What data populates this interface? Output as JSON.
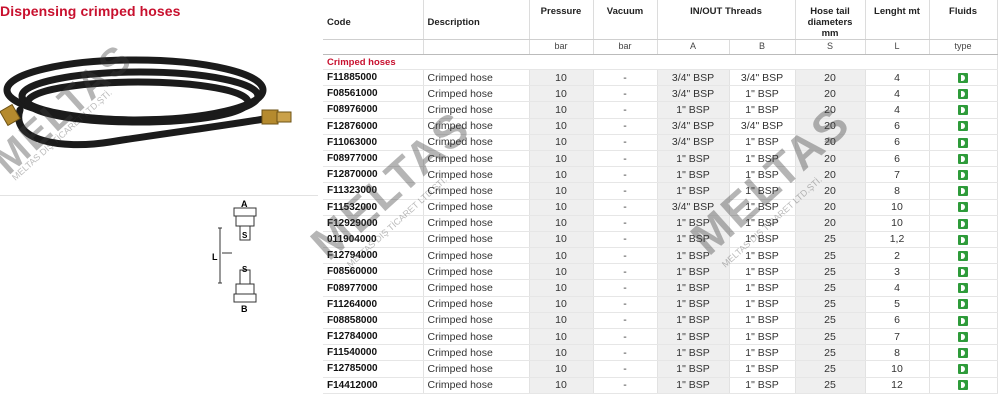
{
  "title": "Dispensing crimped hoses",
  "diagram": {
    "label_a": "A",
    "label_s1": "S",
    "label_l": "L",
    "label_s2": "S",
    "label_b": "B"
  },
  "watermark": {
    "text": "MELTAS",
    "subtext": "MELTAS DIŞ TİCARET LTD.ŞTİ."
  },
  "table": {
    "headers": {
      "code": "Code",
      "description": "Description",
      "pressure": "Pressure",
      "vacuum": "Vacuum",
      "threads": "IN/OUT Threads",
      "hose_tail": "Hose tail diameters mm",
      "length": "Lenght mt",
      "fluids": "Fluids"
    },
    "subheaders": {
      "pressure": "bar",
      "vacuum": "bar",
      "a": "A",
      "b": "B",
      "s": "S",
      "l": "L",
      "fluids": "type"
    },
    "group_label": "Crimped hoses",
    "fluid_icon": "diesel-fluid-icon",
    "fluid_color": "#2e9b3a",
    "rows": [
      {
        "code": "F11885000",
        "desc": "Crimped hose",
        "pressure": "10",
        "vacuum": "-",
        "a": "3/4\" BSP",
        "b": "3/4\" BSP",
        "s": "20",
        "l": "4"
      },
      {
        "code": "F08561000",
        "desc": "Crimped hose",
        "pressure": "10",
        "vacuum": "-",
        "a": "3/4\" BSP",
        "b": "1\" BSP",
        "s": "20",
        "l": "4"
      },
      {
        "code": "F08976000",
        "desc": "Crimped hose",
        "pressure": "10",
        "vacuum": "-",
        "a": "1\" BSP",
        "b": "1\" BSP",
        "s": "20",
        "l": "4"
      },
      {
        "code": "F12876000",
        "desc": "Crimped hose",
        "pressure": "10",
        "vacuum": "-",
        "a": "3/4\" BSP",
        "b": "3/4\" BSP",
        "s": "20",
        "l": "6"
      },
      {
        "code": "F11063000",
        "desc": "Crimped hose",
        "pressure": "10",
        "vacuum": "-",
        "a": "3/4\" BSP",
        "b": "1\" BSP",
        "s": "20",
        "l": "6"
      },
      {
        "code": "F08977000",
        "desc": "Crimped hose",
        "pressure": "10",
        "vacuum": "-",
        "a": "1\" BSP",
        "b": "1\" BSP",
        "s": "20",
        "l": "6"
      },
      {
        "code": "F12870000",
        "desc": "Crimped hose",
        "pressure": "10",
        "vacuum": "-",
        "a": "1\" BSP",
        "b": "1\" BSP",
        "s": "20",
        "l": "7"
      },
      {
        "code": "F11323000",
        "desc": "Crimped hose",
        "pressure": "10",
        "vacuum": "-",
        "a": "1\" BSP",
        "b": "1\" BSP",
        "s": "20",
        "l": "8"
      },
      {
        "code": "F11532000",
        "desc": "Crimped hose",
        "pressure": "10",
        "vacuum": "-",
        "a": "3/4\" BSP",
        "b": "1\" BSP",
        "s": "20",
        "l": "10"
      },
      {
        "code": "F12929000",
        "desc": "Crimped hose",
        "pressure": "10",
        "vacuum": "-",
        "a": "1\" BSP",
        "b": "1\" BSP",
        "s": "20",
        "l": "10"
      },
      {
        "code": "011904000",
        "desc": "Crimped hose",
        "pressure": "10",
        "vacuum": "-",
        "a": "1\" BSP",
        "b": "1\" BSP",
        "s": "25",
        "l": "1,2"
      },
      {
        "code": "F12794000",
        "desc": "Crimped hose",
        "pressure": "10",
        "vacuum": "-",
        "a": "1\" BSP",
        "b": "1\" BSP",
        "s": "25",
        "l": "2"
      },
      {
        "code": "F08560000",
        "desc": "Crimped hose",
        "pressure": "10",
        "vacuum": "-",
        "a": "1\" BSP",
        "b": "1\" BSP",
        "s": "25",
        "l": "3"
      },
      {
        "code": "F08977000",
        "desc": "Crimped hose",
        "pressure": "10",
        "vacuum": "-",
        "a": "1\" BSP",
        "b": "1\" BSP",
        "s": "25",
        "l": "4"
      },
      {
        "code": "F11264000",
        "desc": "Crimped hose",
        "pressure": "10",
        "vacuum": "-",
        "a": "1\" BSP",
        "b": "1\" BSP",
        "s": "25",
        "l": "5"
      },
      {
        "code": "F08858000",
        "desc": "Crimped hose",
        "pressure": "10",
        "vacuum": "-",
        "a": "1\" BSP",
        "b": "1\" BSP",
        "s": "25",
        "l": "6"
      },
      {
        "code": "F12784000",
        "desc": "Crimped hose",
        "pressure": "10",
        "vacuum": "-",
        "a": "1\" BSP",
        "b": "1\" BSP",
        "s": "25",
        "l": "7"
      },
      {
        "code": "F11540000",
        "desc": "Crimped hose",
        "pressure": "10",
        "vacuum": "-",
        "a": "1\" BSP",
        "b": "1\" BSP",
        "s": "25",
        "l": "8"
      },
      {
        "code": "F12785000",
        "desc": "Crimped hose",
        "pressure": "10",
        "vacuum": "-",
        "a": "1\" BSP",
        "b": "1\" BSP",
        "s": "25",
        "l": "10"
      },
      {
        "code": "F14412000",
        "desc": "Crimped hose",
        "pressure": "10",
        "vacuum": "-",
        "a": "1\" BSP",
        "b": "1\" BSP",
        "s": "25",
        "l": "12"
      }
    ]
  }
}
